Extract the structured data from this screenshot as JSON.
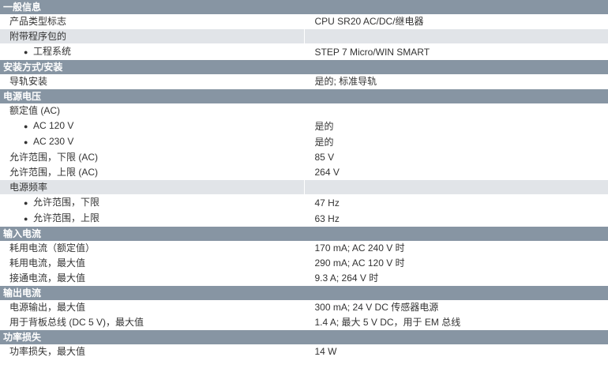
{
  "sections": [
    {
      "title": "一般信息",
      "rows": [
        {
          "label": "产品类型标志",
          "value": "CPU SR20 AC/DC/继电器",
          "style": "white",
          "indent": "sub"
        },
        {
          "label": "附带程序包的",
          "value": "",
          "style": "grey",
          "indent": "sub"
        },
        {
          "label": "工程系统",
          "value": "STEP 7 Micro/WIN SMART",
          "style": "white",
          "indent": "bullet"
        }
      ]
    },
    {
      "title": "安装方式/安装",
      "rows": [
        {
          "label": "导轨安装",
          "value": "是的; 标准导轨",
          "style": "white",
          "indent": "sub"
        }
      ]
    },
    {
      "title": "电源电压",
      "rows": [
        {
          "label": "额定值 (AC)",
          "value": "",
          "style": "white",
          "indent": "sub"
        },
        {
          "label": "AC 120 V",
          "value": "是的",
          "style": "white",
          "indent": "bullet"
        },
        {
          "label": "AC 230 V",
          "value": "是的",
          "style": "white",
          "indent": "bullet"
        },
        {
          "label": "允许范围，下限 (AC)",
          "value": "85 V",
          "style": "white",
          "indent": "sub"
        },
        {
          "label": "允许范围，上限 (AC)",
          "value": "264 V",
          "style": "white",
          "indent": "sub"
        },
        {
          "label": "电源频率",
          "value": "",
          "style": "grey",
          "indent": "sub"
        },
        {
          "label": "允许范围，下限",
          "value": "47 Hz",
          "style": "white",
          "indent": "bullet"
        },
        {
          "label": "允许范围，上限",
          "value": "63 Hz",
          "style": "white",
          "indent": "bullet"
        }
      ]
    },
    {
      "title": "输入电流",
      "rows": [
        {
          "label": "耗用电流（额定值）",
          "value": "170 mA; AC 240 V 时",
          "style": "white",
          "indent": "sub"
        },
        {
          "label": "耗用电流，最大值",
          "value": "290 mA; AC 120 V 时",
          "style": "white",
          "indent": "sub"
        },
        {
          "label": "接通电流，最大值",
          "value": "9.3 A; 264 V 时",
          "style": "white",
          "indent": "sub"
        }
      ]
    },
    {
      "title": "输出电流",
      "rows": [
        {
          "label": "电源输出，最大值",
          "value": "300 mA; 24 V DC 传感器电源",
          "style": "white",
          "indent": "sub"
        },
        {
          "label": "用于背板总线 (DC 5 V)，最大值",
          "value": "1.4 A; 最大 5 V DC，用于 EM 总线",
          "style": "white",
          "indent": "sub"
        }
      ]
    },
    {
      "title": "功率损失",
      "rows": [
        {
          "label": "功率损失，最大值",
          "value": "14 W",
          "style": "white",
          "indent": "sub"
        }
      ]
    }
  ],
  "bullet_symbol": "●"
}
